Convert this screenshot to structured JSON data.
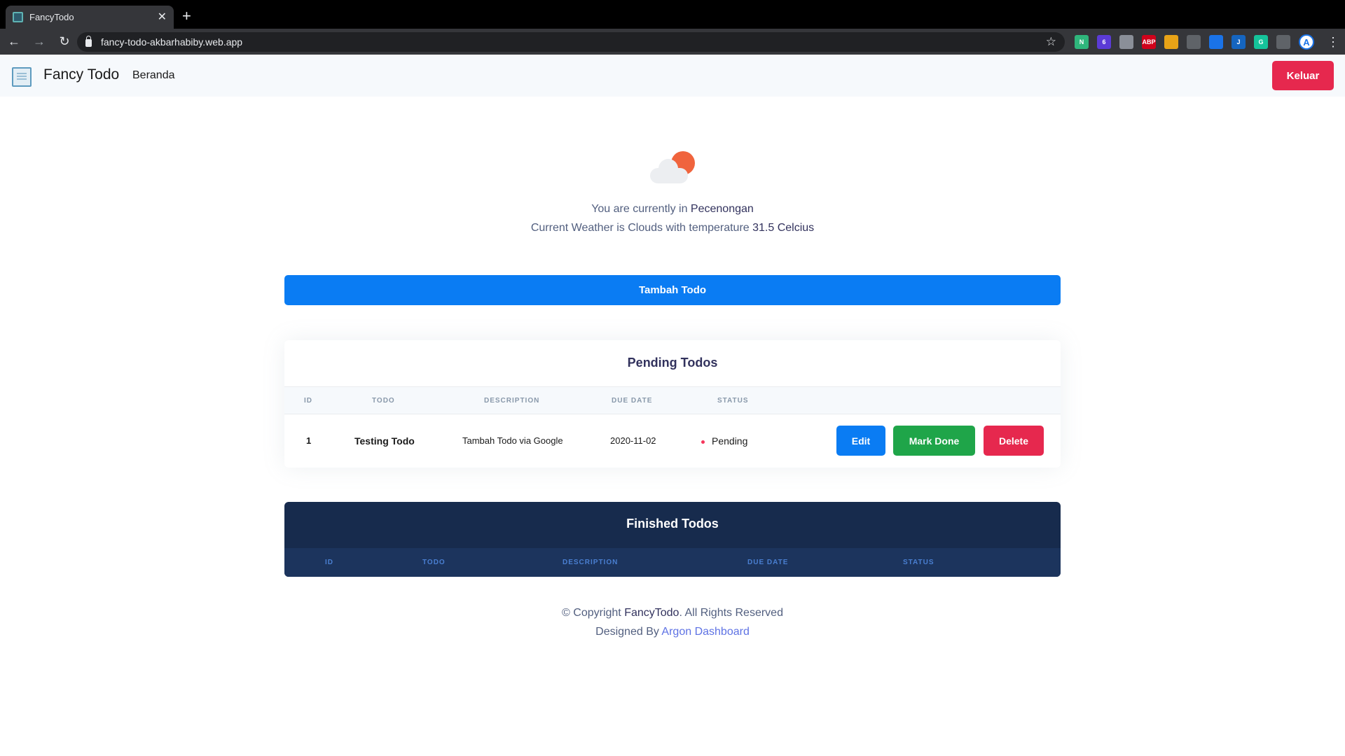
{
  "browser": {
    "tab_title": "FancyTodo",
    "url": "fancy-todo-akbarhabiby.web.app",
    "profile_initial": "A",
    "extensions": [
      {
        "icon": "n-extension-icon",
        "label": "N",
        "color": "#2fb67c"
      },
      {
        "icon": "badge-extension-icon",
        "label": "6",
        "color": "#5b3bd6"
      },
      {
        "icon": "printer-extension-icon",
        "label": "",
        "color": "#8a8f98"
      },
      {
        "icon": "abp-extension-icon",
        "label": "ABP",
        "color": "#d0021b"
      },
      {
        "icon": "color-extension-icon",
        "label": "",
        "color": "#e8a317"
      },
      {
        "icon": "crop-extension-icon",
        "label": "",
        "color": "#5f6368"
      },
      {
        "icon": "link-extension-icon",
        "label": "",
        "color": "#1a73e8"
      },
      {
        "icon": "j-extension-icon",
        "label": "J",
        "color": "#1565c0"
      },
      {
        "icon": "grammarly-extension-icon",
        "label": "G",
        "color": "#15c39a"
      },
      {
        "icon": "puzzle-extension-icon",
        "label": "",
        "color": "#5f6368"
      }
    ]
  },
  "navbar": {
    "brand": "Fancy Todo",
    "home_link": "Beranda",
    "logout_label": "Keluar"
  },
  "weather": {
    "location_prefix": "You are currently in ",
    "location": "Pecenongan",
    "weather_prefix": "Current Weather is Clouds with temperature ",
    "temperature": "31.5 Celcius"
  },
  "add_todo_label": "Tambah Todo",
  "pending": {
    "title": "Pending Todos",
    "columns": [
      "ID",
      "TODO",
      "DESCRIPTION",
      "DUE DATE",
      "STATUS"
    ],
    "rows": [
      {
        "id": "1",
        "todo": "Testing Todo",
        "description": "Tambah Todo via Google",
        "due_date": "2020-11-02",
        "status": "Pending"
      }
    ],
    "actions": {
      "edit": "Edit",
      "mark_done": "Mark Done",
      "delete": "Delete"
    },
    "colors": {
      "edit": "#0a7cf3",
      "mark_done": "#1fa549",
      "delete": "#e6284e",
      "status_dot": "#f5365c"
    }
  },
  "finished": {
    "title": "Finished Todos",
    "columns": [
      "ID",
      "TODO",
      "DESCRIPTION",
      "DUE DATE",
      "STATUS"
    ]
  },
  "footer": {
    "copyright_prefix": "© Copyright ",
    "copyright_brand": "FancyTodo",
    "copyright_suffix": ". All Rights Reserved",
    "designed_prefix": "Designed By ",
    "designed_link": "Argon Dashboard"
  }
}
